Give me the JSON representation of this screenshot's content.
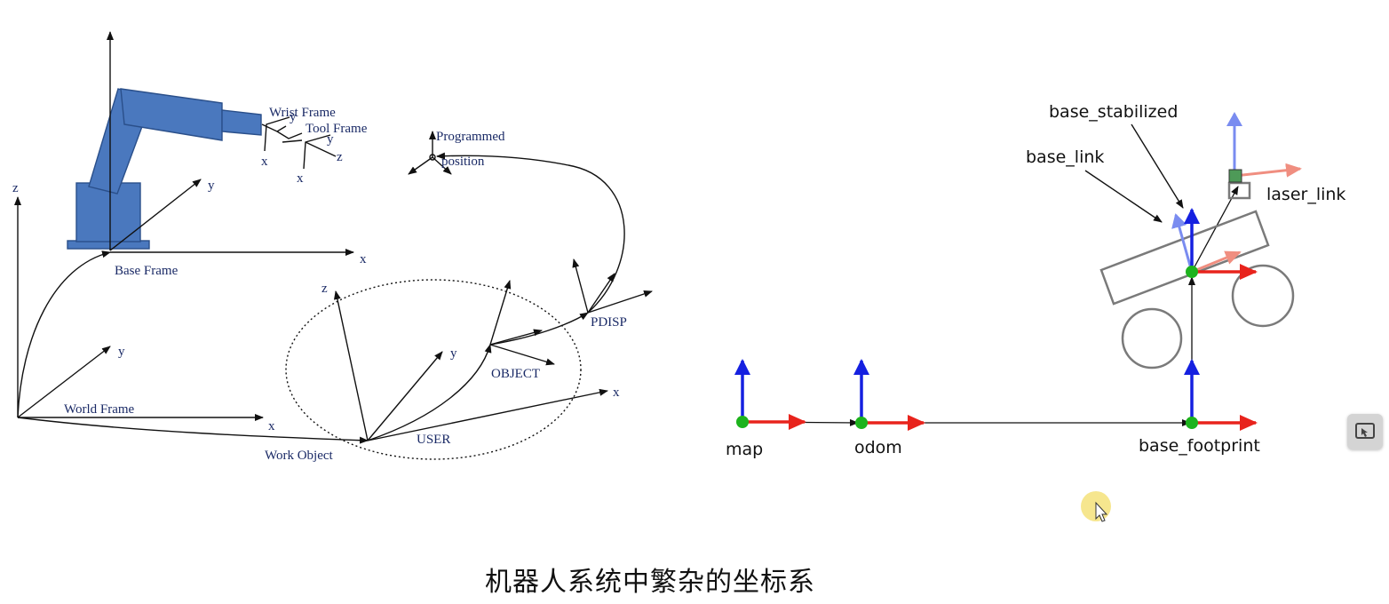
{
  "left_diagram": {
    "labels": {
      "wrist_frame": "Wrist Frame",
      "tool_frame": "Tool Frame",
      "base_frame": "Base Frame",
      "world_frame": "World Frame",
      "work_object": "Work Object",
      "user": "USER",
      "object": "OBJECT",
      "pdisp": "PDISP",
      "programmed": "Programmed",
      "position": "position"
    },
    "axes": {
      "x": "x",
      "y": "y",
      "z": "z"
    },
    "colors": {
      "robot": "#4a78be",
      "robot_stroke": "#2a4f8a",
      "ink": "#111111",
      "label": "#1a2a66"
    }
  },
  "right_diagram": {
    "frames": {
      "map": "map",
      "odom": "odom",
      "base_footprint": "base_footprint",
      "base_link": "base_link",
      "base_stabilized": "base_stabilized",
      "laser_link": "laser_link"
    },
    "colors": {
      "x_axis": "#e8231c",
      "z_axis": "#1520e0",
      "origin": "#1db31d",
      "body": "#7a7a7a"
    }
  },
  "caption": "机器人系统中繁杂的坐标系",
  "icons": {
    "side_button": "screen-pointer-icon",
    "cursor": "mouse-cursor-icon"
  }
}
